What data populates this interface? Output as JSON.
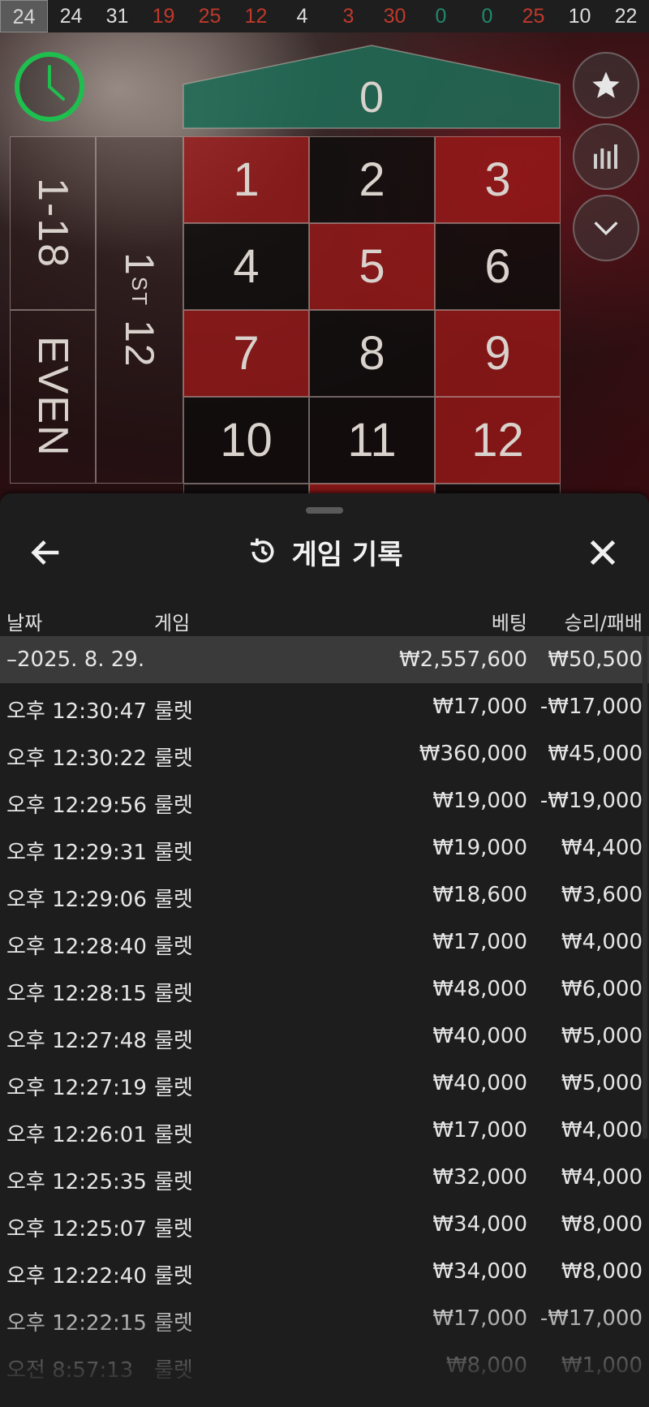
{
  "results": [
    {
      "n": "24",
      "color": "red",
      "current": true
    },
    {
      "n": "24",
      "color": "black"
    },
    {
      "n": "31",
      "color": "black"
    },
    {
      "n": "19",
      "color": "red"
    },
    {
      "n": "25",
      "color": "red"
    },
    {
      "n": "12",
      "color": "red"
    },
    {
      "n": "4",
      "color": "black"
    },
    {
      "n": "3",
      "color": "red"
    },
    {
      "n": "30",
      "color": "red"
    },
    {
      "n": "0",
      "color": "green"
    },
    {
      "n": "0",
      "color": "green"
    },
    {
      "n": "25",
      "color": "red"
    },
    {
      "n": "10",
      "color": "black"
    },
    {
      "n": "22",
      "color": "black"
    }
  ],
  "table": {
    "zero": "0",
    "numbers": [
      {
        "n": "1",
        "color": "red"
      },
      {
        "n": "2",
        "color": "black"
      },
      {
        "n": "3",
        "color": "red"
      },
      {
        "n": "4",
        "color": "black"
      },
      {
        "n": "5",
        "color": "red"
      },
      {
        "n": "6",
        "color": "black"
      },
      {
        "n": "7",
        "color": "red"
      },
      {
        "n": "8",
        "color": "black"
      },
      {
        "n": "9",
        "color": "red"
      },
      {
        "n": "10",
        "color": "black"
      },
      {
        "n": "11",
        "color": "black"
      },
      {
        "n": "12",
        "color": "red"
      }
    ],
    "low_label": "1-18",
    "even_label": "EVEN",
    "dozen_label": "1ST 12"
  },
  "side_buttons": [
    "star-icon",
    "stats-icon",
    "chevron-down-icon"
  ],
  "sheet": {
    "title": "게임 기록",
    "columns": {
      "date": "날짜",
      "game": "게임",
      "bet": "베팅",
      "winloss": "승리/패배"
    },
    "date_row": {
      "date": "–2025. 8. 29.",
      "bet": "₩2,557,600",
      "winloss": "₩50,500"
    },
    "rows": [
      {
        "time": "오후 12:30:47",
        "game": "룰렛",
        "bet": "₩17,000",
        "winloss": "-₩17,000"
      },
      {
        "time": "오후 12:30:22",
        "game": "룰렛",
        "bet": "₩360,000",
        "winloss": "₩45,000"
      },
      {
        "time": "오후 12:29:56",
        "game": "룰렛",
        "bet": "₩19,000",
        "winloss": "-₩19,000"
      },
      {
        "time": "오후 12:29:31",
        "game": "룰렛",
        "bet": "₩19,000",
        "winloss": "₩4,400"
      },
      {
        "time": "오후 12:29:06",
        "game": "룰렛",
        "bet": "₩18,600",
        "winloss": "₩3,600"
      },
      {
        "time": "오후 12:28:40",
        "game": "룰렛",
        "bet": "₩17,000",
        "winloss": "₩4,000"
      },
      {
        "time": "오후 12:28:15",
        "game": "룰렛",
        "bet": "₩48,000",
        "winloss": "₩6,000"
      },
      {
        "time": "오후 12:27:48",
        "game": "룰렛",
        "bet": "₩40,000",
        "winloss": "₩5,000"
      },
      {
        "time": "오후 12:27:19",
        "game": "룰렛",
        "bet": "₩40,000",
        "winloss": "₩5,000"
      },
      {
        "time": "오후 12:26:01",
        "game": "룰렛",
        "bet": "₩17,000",
        "winloss": "₩4,000"
      },
      {
        "time": "오후 12:25:35",
        "game": "룰렛",
        "bet": "₩32,000",
        "winloss": "₩4,000"
      },
      {
        "time": "오후 12:25:07",
        "game": "룰렛",
        "bet": "₩34,000",
        "winloss": "₩8,000"
      },
      {
        "time": "오후 12:22:40",
        "game": "룰렛",
        "bet": "₩34,000",
        "winloss": "₩8,000"
      },
      {
        "time": "오후 12:22:15",
        "game": "룰렛",
        "bet": "₩17,000",
        "winloss": "-₩17,000"
      },
      {
        "time": "오전 8:57:13",
        "game": "룰렛",
        "bet": "₩8,000",
        "winloss": "₩1,000"
      }
    ]
  },
  "colors": {
    "red": "#c0392b",
    "green_timer": "#1fbf4f",
    "zero_felt": "#1f6b55",
    "sheet_bg": "#1d1d1d"
  }
}
